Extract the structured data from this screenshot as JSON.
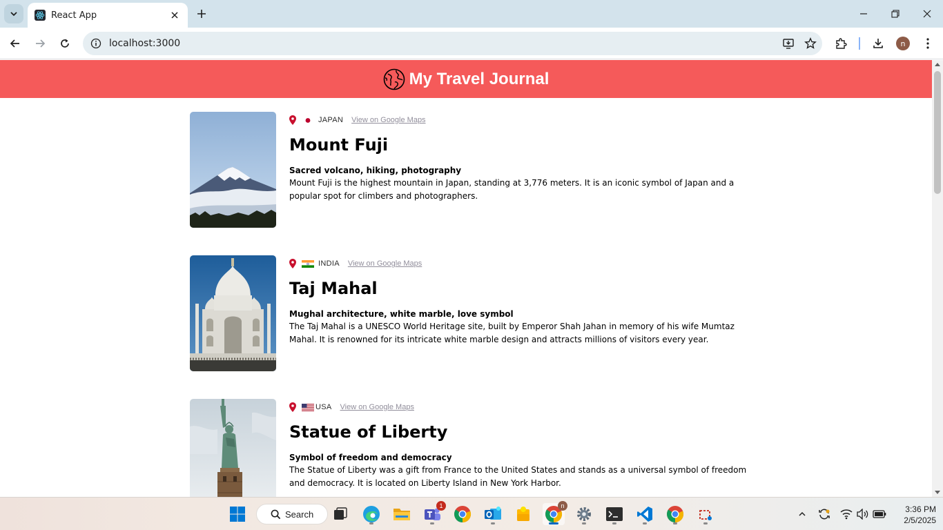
{
  "browser": {
    "tab_title": "React App",
    "url": "localhost:3000",
    "profile_initial": "n"
  },
  "page": {
    "header_title": "My Travel Journal",
    "header_color": "#f55a5a",
    "entries": [
      {
        "country": "JAPAN",
        "flag": "japan-flag",
        "maps_link": "View on Google Maps",
        "title": "Mount Fuji",
        "tags": "Sacred volcano, hiking, photography",
        "description": "Mount Fuji is the highest mountain in Japan, standing at 3,776 meters. It is an iconic symbol of Japan and a popular spot for climbers and photographers.",
        "image": "mount-fuji-photo"
      },
      {
        "country": "INDIA",
        "flag": "india-flag",
        "maps_link": "View on Google Maps",
        "title": "Taj Mahal",
        "tags": "Mughal architecture, white marble, love symbol",
        "description": "The Taj Mahal is a UNESCO World Heritage site, built by Emperor Shah Jahan in memory of his wife Mumtaz Mahal. It is renowned for its intricate white marble design and attracts millions of visitors every year.",
        "image": "taj-mahal-photo"
      },
      {
        "country": "USA",
        "flag": "usa-flag",
        "maps_link": "View on Google Maps",
        "title": "Statue of Liberty",
        "tags": "Symbol of freedom and democracy",
        "description": "The Statue of Liberty was a gift from France to the United States and stands as a universal symbol of freedom and democracy. It is located on Liberty Island in New York Harbor.",
        "image": "statue-of-liberty-photo"
      }
    ]
  },
  "taskbar": {
    "search_label": "Search",
    "teams_badge": "1",
    "chrome_profile_badge": "n",
    "time": "3:36 PM",
    "date": "2/5/2025"
  }
}
